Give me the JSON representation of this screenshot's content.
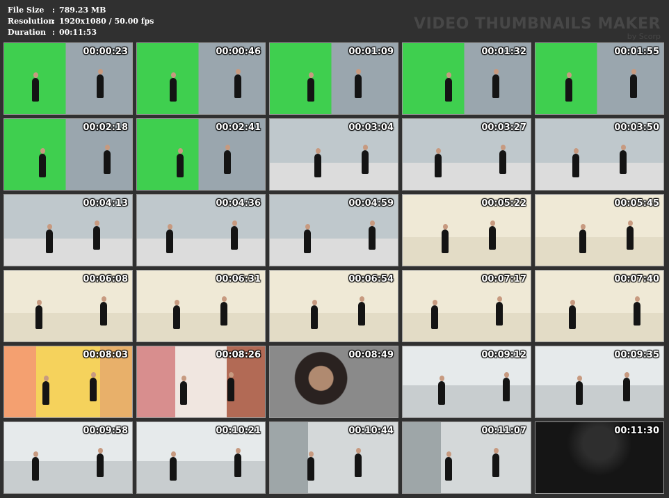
{
  "header": {
    "file_size_label": "File Size",
    "file_size_value": "789.23 MB",
    "resolution_label": "Resolution",
    "resolution_value": "1920x1080 / 50.00 fps",
    "duration_label": "Duration",
    "duration_value": "00:11:53",
    "watermark_title": "VIDEO THUMBNAILS MAKER",
    "watermark_sub": "by Scorp"
  },
  "thumbnails": [
    {
      "time": "00:00:23",
      "scene": "green"
    },
    {
      "time": "00:00:46",
      "scene": "green"
    },
    {
      "time": "00:01:09",
      "scene": "green"
    },
    {
      "time": "00:01:32",
      "scene": "green"
    },
    {
      "time": "00:01:55",
      "scene": "green"
    },
    {
      "time": "00:02:18",
      "scene": "green"
    },
    {
      "time": "00:02:41",
      "scene": "green"
    },
    {
      "time": "00:03:04",
      "scene": "gray"
    },
    {
      "time": "00:03:27",
      "scene": "gray"
    },
    {
      "time": "00:03:50",
      "scene": "gray"
    },
    {
      "time": "00:04:13",
      "scene": "gray"
    },
    {
      "time": "00:04:36",
      "scene": "gray"
    },
    {
      "time": "00:04:59",
      "scene": "gray"
    },
    {
      "time": "00:05:22",
      "scene": "cream"
    },
    {
      "time": "00:05:45",
      "scene": "cream"
    },
    {
      "time": "00:06:08",
      "scene": "cream"
    },
    {
      "time": "00:06:31",
      "scene": "cream"
    },
    {
      "time": "00:06:54",
      "scene": "cream"
    },
    {
      "time": "00:07:17",
      "scene": "cream"
    },
    {
      "time": "00:07:40",
      "scene": "cream"
    },
    {
      "time": "00:08:03",
      "scene": "yellow"
    },
    {
      "time": "00:08:26",
      "scene": "pink"
    },
    {
      "time": "00:08:49",
      "scene": "portrait"
    },
    {
      "time": "00:09:12",
      "scene": "stairs"
    },
    {
      "time": "00:09:35",
      "scene": "stairs"
    },
    {
      "time": "00:09:58",
      "scene": "stairs"
    },
    {
      "time": "00:10:21",
      "scene": "stairs"
    },
    {
      "time": "00:10:44",
      "scene": "hall"
    },
    {
      "time": "00:11:07",
      "scene": "hall"
    },
    {
      "time": "00:11:30",
      "scene": "dark"
    }
  ],
  "scene_colors": {
    "green": "#3fcf4f",
    "gray": "#a9b1b6",
    "cream": "#e8e2cf",
    "yellow": "#f1c75a",
    "pink": "#d89999",
    "portrait": "#6b6b6b",
    "stairs": "#d9dee0",
    "hall": "#b9c0c2",
    "dark": "#1d1d1d"
  }
}
